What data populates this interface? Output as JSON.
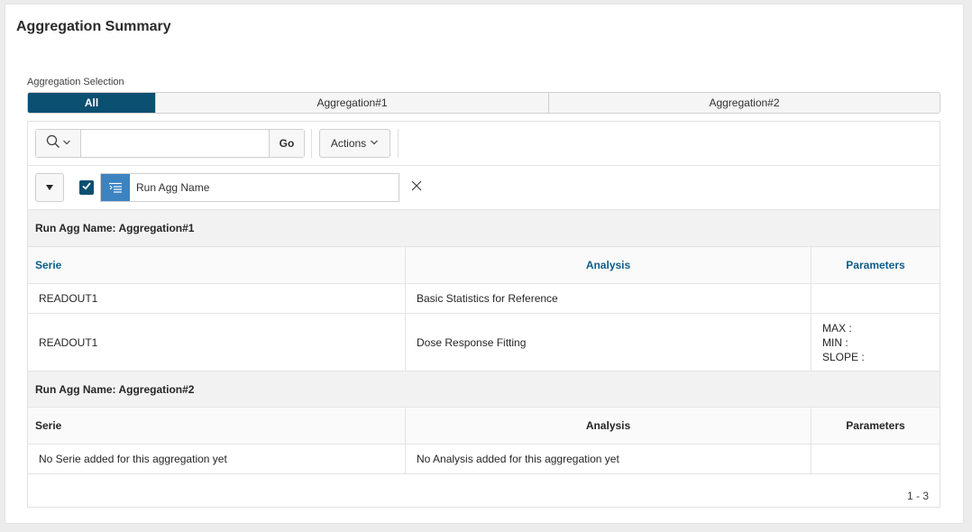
{
  "region": {
    "title": "Aggregation Summary"
  },
  "selection": {
    "label": "Aggregation Selection",
    "tabs": [
      {
        "label": "All",
        "active": true
      },
      {
        "label": "Aggregation#1",
        "active": false
      },
      {
        "label": "Aggregation#2",
        "active": false
      }
    ]
  },
  "toolbar": {
    "search_value": "",
    "search_placeholder": "",
    "go_label": "Go",
    "actions_label": "Actions"
  },
  "filter": {
    "label": "Run Agg Name",
    "checked": true
  },
  "groups": [
    {
      "break_label": "Run Agg Name: Aggregation#1",
      "headers": [
        "Serie",
        "Analysis",
        "Parameters"
      ],
      "rows": [
        {
          "serie": "READOUT1",
          "analysis": "Basic Statistics for Reference",
          "parameters": []
        },
        {
          "serie": "READOUT1",
          "analysis": "Dose Response Fitting",
          "parameters": [
            "MAX :",
            "MIN :",
            "SLOPE :"
          ]
        }
      ]
    },
    {
      "break_label": "Run Agg Name: Aggregation#2",
      "headers": [
        "Serie",
        "Analysis",
        "Parameters"
      ],
      "rows": [
        {
          "serie": "No Serie added for this aggregation yet",
          "analysis": "No Analysis added for this aggregation yet",
          "parameters": []
        }
      ]
    }
  ],
  "pagination": {
    "text": "1 - 3"
  },
  "colors": {
    "accent": "#0b4f71",
    "filter_icon_bg": "#3c83c2",
    "link_header": "#0b5d8a"
  },
  "icons": {
    "search": "search-icon",
    "chevron": "chevron-down-icon",
    "collapse": "triangle-down-icon",
    "check": "check-icon",
    "filter": "filter-icon",
    "remove": "close-icon"
  }
}
